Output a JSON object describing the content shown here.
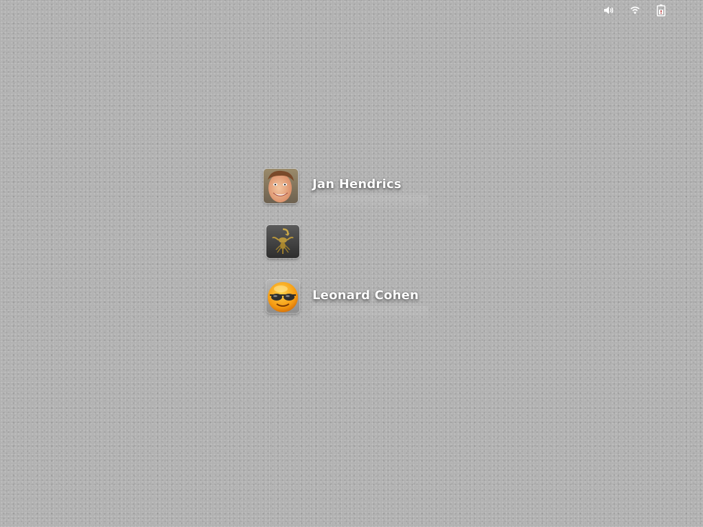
{
  "panel": {
    "indicators": [
      {
        "icon": "speaker-volume-icon"
      },
      {
        "icon": "wifi-icon"
      },
      {
        "icon": "battery-icon"
      }
    ]
  },
  "users": [
    {
      "name": "Jan Hendrics",
      "avatar": "face-photo-avatar",
      "name_visible": true
    },
    {
      "name": "",
      "avatar": "scorpion-avatar",
      "name_visible": false
    },
    {
      "name": "Leonard Cohen",
      "avatar": "sunglasses-smiley-avatar",
      "name_visible": true
    }
  ],
  "colors": {
    "background": "#adadad",
    "name_text": "#ffffff"
  }
}
